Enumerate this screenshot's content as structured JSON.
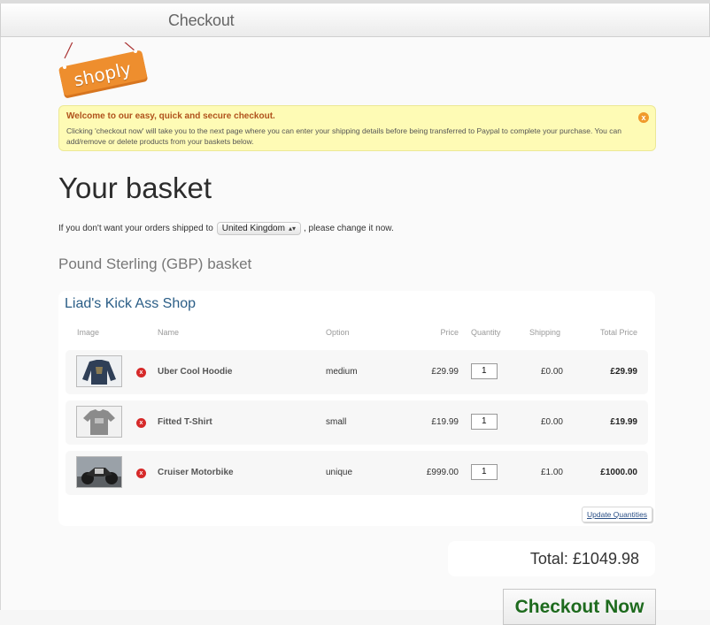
{
  "header": {
    "title": "Checkout"
  },
  "logo": {
    "text": "shoply",
    "color": "#e8882a"
  },
  "notice": {
    "title": "Welcome to our easy, quick and secure checkout.",
    "body": "Clicking 'checkout now' will take you to the next page where you can enter your shipping details before being transferred to Paypal to complete your purchase. You can add/remove or delete products from your baskets below.",
    "close_label": "x"
  },
  "basket": {
    "title": "Your basket",
    "ship_prefix": "If you don't want your orders shipped to",
    "country": "United Kingdom",
    "ship_suffix": ", please change it now.",
    "currency_title": "Pound Sterling (GBP) basket"
  },
  "shop": {
    "name": "Liad's Kick Ass Shop",
    "columns": {
      "image": "Image",
      "name": "Name",
      "option": "Option",
      "price": "Price",
      "quantity": "Quantity",
      "shipping": "Shipping",
      "total": "Total Price"
    },
    "items": [
      {
        "name": "Uber Cool Hoodie",
        "option": "medium",
        "price": "£29.99",
        "quantity": "1",
        "shipping": "£0.00",
        "total": "£29.99",
        "image_icon": "hoodie-image"
      },
      {
        "name": "Fitted T-Shirt",
        "option": "small",
        "price": "£19.99",
        "quantity": "1",
        "shipping": "£0.00",
        "total": "£19.99",
        "image_icon": "tshirt-image"
      },
      {
        "name": "Cruiser Motorbike",
        "option": "unique",
        "price": "£999.00",
        "quantity": "1",
        "shipping": "£1.00",
        "total": "£1000.00",
        "image_icon": "motorbike-image"
      }
    ],
    "remove_symbol": "x",
    "update_label": "Update Quantities"
  },
  "summary": {
    "total": "Total: £1049.98",
    "checkout_label": "Checkout Now",
    "checkout_color": "#1d6a1d"
  }
}
